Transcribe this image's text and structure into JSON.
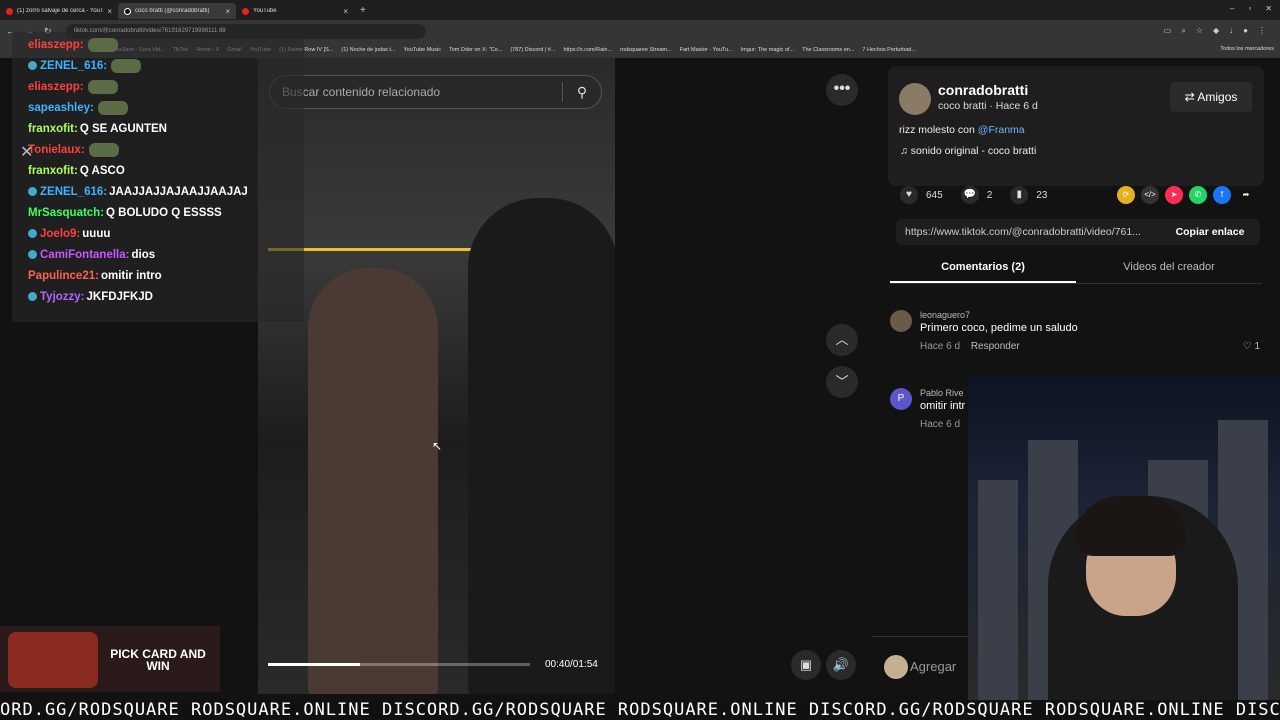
{
  "browser": {
    "tabs": [
      {
        "label": "(1) zorro salvaje de cerca - YouT",
        "active": false
      },
      {
        "label": "coco bratti (@conradobratti)",
        "active": true
      },
      {
        "label": "YouTube",
        "active": false
      }
    ],
    "url": "tiktok.com/@conradobratti/video/76191629719998111 88",
    "bookmarks": [
      "SoraSave - Sora Vid...",
      "TikTok",
      "Home / X",
      "Gmail",
      "YouTube",
      "(1) Saints Row IV [S...",
      "(1) Noche de jodas t...",
      "YouTube Music",
      "Tom Dder on X: \"Co...",
      "(787) Discord | #...",
      "https://x.com/Rain...",
      "rodsquaree Stream...",
      "Fart Master - YouTu...",
      "Imgur: The magic of...",
      "The Classrooms en...",
      "7 Hechos Perturbad..."
    ],
    "bookmarks_all": "Todos los marcadores"
  },
  "chat": {
    "lines": [
      {
        "user": "eliaszepp:",
        "color": "#ff4040",
        "msg": "",
        "emote": true
      },
      {
        "user": "ZENEL_616:",
        "color": "#3cb4ff",
        "msg": "",
        "emote": true,
        "badge": true
      },
      {
        "user": "eliaszepp:",
        "color": "#ff4040",
        "msg": "",
        "emote": true
      },
      {
        "user": "sapeashley:",
        "color": "#3cb4ff",
        "msg": "",
        "emote": true
      },
      {
        "user": "franxofit:",
        "color": "#b0ff60",
        "msg": "Q SE AGUNTEN",
        "emote": false
      },
      {
        "user": "Tonielaux:",
        "color": "#ff4040",
        "msg": "",
        "emote": true
      },
      {
        "user": "franxofit:",
        "color": "#b0ff60",
        "msg": "Q ASCO",
        "emote": false
      },
      {
        "user": "ZENEL_616:",
        "color": "#3cb4ff",
        "msg": "JAAJJAJJAJAAJJAAJAJ",
        "emote": false,
        "badge": true
      },
      {
        "user": "MrSasquatch:",
        "color": "#40ff60",
        "msg": "Q BOLUDO Q ESSSS",
        "emote": false
      },
      {
        "user": "Joelo9:",
        "color": "#ff4040",
        "msg": "uuuu",
        "emote": false,
        "badge": true
      },
      {
        "user": "CamiFontanella:",
        "color": "#cc55ff",
        "msg": "dios",
        "emote": false,
        "badge": true
      },
      {
        "user": "Papulince21:",
        "color": "#ff6050",
        "msg": "omitir intro",
        "emote": false
      },
      {
        "user": "Tyjozzy:",
        "color": "#b066ff",
        "msg": "JKFDJFKJD",
        "emote": false,
        "badge": true
      }
    ]
  },
  "promo": {
    "text": "PICK CARD AND WIN"
  },
  "video": {
    "search_placeholder": "Buscar contenido relacionado",
    "time": "00:40/01:54",
    "progress": 0.35
  },
  "creator": {
    "name": "conradobratti",
    "sub": "coco bratti · Hace 6 d",
    "friends_label": "Amigos",
    "desc": "rizz molesto con ",
    "mention": "@Franma",
    "sound": "sonido original - coco bratti"
  },
  "stats": {
    "likes": "645",
    "comments": "2",
    "saves": "23"
  },
  "link": {
    "url": "https://www.tiktok.com/@conradobratti/video/761...",
    "copy_label": "Copiar enlace"
  },
  "tabs": {
    "comments": "Comentarios (2)",
    "creator_videos": "Videos del creador"
  },
  "comments": [
    {
      "user": "leonaguero7",
      "text": "Primero coco, pedime un saludo",
      "meta": "Hace 6 d",
      "reply": "Responder",
      "likes": "1",
      "initial": ""
    },
    {
      "user": "Pablo Rive",
      "text": "omitir intr",
      "meta": "Hace 6 d",
      "reply": "",
      "likes": "",
      "initial": "P"
    }
  ],
  "add_comment": {
    "placeholder": "Agregar"
  },
  "ticker": {
    "text": "ORD.GG/RODSQUARE RODSQUARE.ONLINE DISCORD.GG/RODSQUARE RODSQUARE.ONLINE DISCORD.GG/RODSQUARE RODSQUARE.ONLINE DISC"
  }
}
